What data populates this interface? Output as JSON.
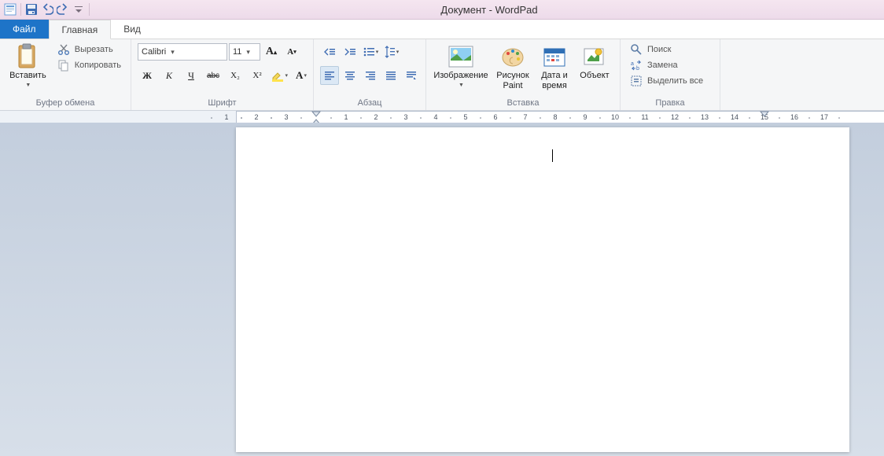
{
  "title": "Документ - WordPad",
  "tabs": {
    "file": "Файл",
    "home": "Главная",
    "view": "Вид"
  },
  "clipboard": {
    "paste": "Вставить",
    "cut": "Вырезать",
    "copy": "Копировать",
    "label": "Буфер обмена"
  },
  "font": {
    "family": "Calibri",
    "size": "11",
    "label": "Шрифт",
    "bold": "Ж",
    "italic": "К",
    "underline": "Ч",
    "strike": "abc",
    "sub": "X₂",
    "sup": "X²",
    "grow": "A",
    "shrink": "A"
  },
  "paragraph": {
    "label": "Абзац"
  },
  "insert": {
    "image": "Изображение",
    "paint": "Рисунок Paint",
    "datetime": "Дата и время",
    "object": "Объект",
    "label": "Вставка"
  },
  "editing": {
    "find": "Поиск",
    "replace": "Замена",
    "selectall": "Выделить все",
    "label": "Правка"
  },
  "ruler": {
    "neg": [
      "3",
      "2",
      "1"
    ],
    "pos": [
      "1",
      "2",
      "3",
      "4",
      "5",
      "6",
      "7",
      "8",
      "9",
      "10",
      "11",
      "12",
      "13",
      "14",
      "15",
      "16",
      "17"
    ]
  }
}
